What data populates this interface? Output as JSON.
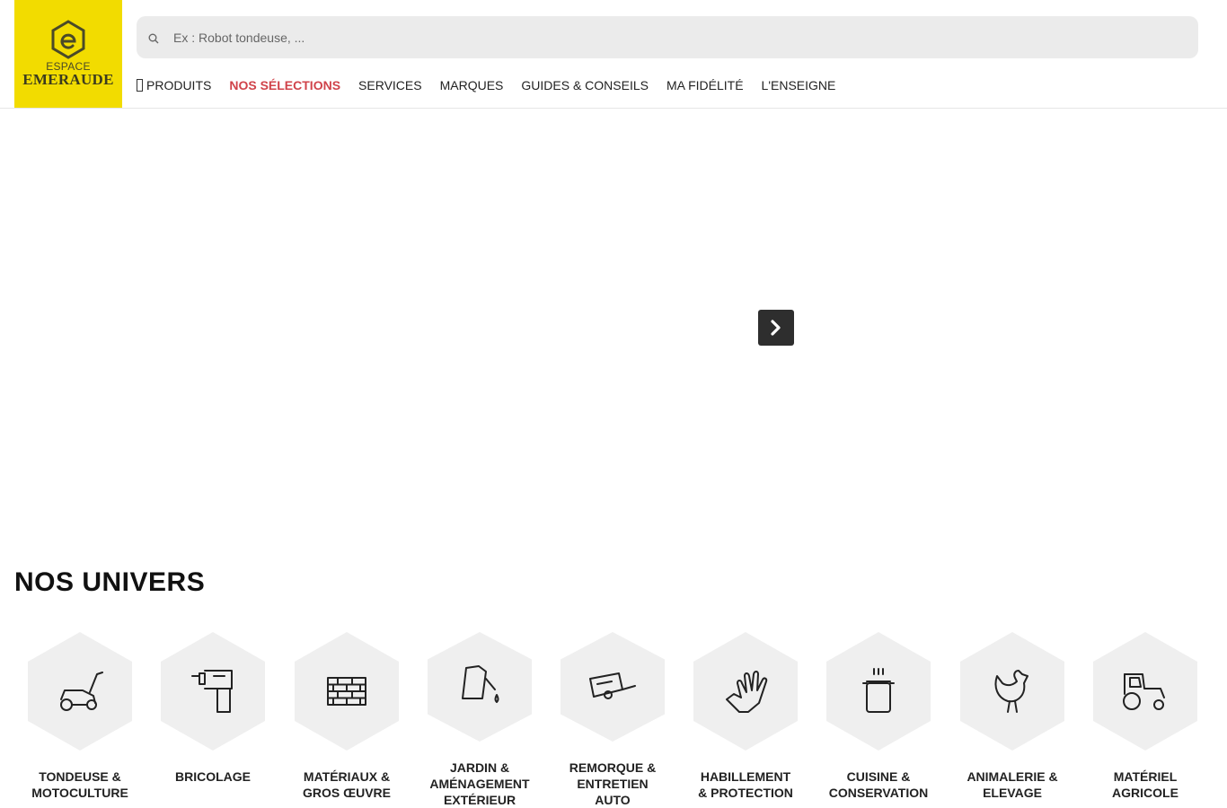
{
  "brand": {
    "logo_line1": "ESPACE",
    "logo_line2": "EMERAUDE",
    "color": "#f2dc00"
  },
  "search": {
    "placeholder": "Ex : Robot tondeuse, ...",
    "icon": "search-icon"
  },
  "nav": {
    "items": [
      {
        "label": "PRODUITS",
        "icon": "menu-icon"
      },
      {
        "label": "NOS SÉLECTIONS",
        "active": true
      },
      {
        "label": "SERVICES"
      },
      {
        "label": "MARQUES"
      },
      {
        "label": "GUIDES & CONSEILS"
      },
      {
        "label": "MA FIDÉLITÉ"
      },
      {
        "label": "L'ENSEIGNE"
      }
    ],
    "active_color": "#d0434a"
  },
  "slider": {
    "next_icon": "chevron-right-icon"
  },
  "univers": {
    "title": "NOS UNIVERS",
    "items": [
      {
        "label_l1": "TONDEUSE &",
        "label_l2": "MOTOCULTURE",
        "label_l3": "",
        "icon": "lawnmower-icon"
      },
      {
        "label_l1": "BRICOLAGE",
        "label_l2": "",
        "label_l3": "",
        "icon": "drill-icon"
      },
      {
        "label_l1": "MATÉRIAUX &",
        "label_l2": "GROS ŒUVRE",
        "label_l3": "",
        "icon": "bricks-icon"
      },
      {
        "label_l1": "JARDIN &",
        "label_l2": "AMÉNAGEMENT",
        "label_l3": "EXTÉRIEUR",
        "icon": "watering-can-icon"
      },
      {
        "label_l1": "REMORQUE &",
        "label_l2": "ENTRETIEN",
        "label_l3": "AUTO",
        "icon": "trailer-icon"
      },
      {
        "label_l1": "HABILLEMENT",
        "label_l2": "& PROTECTION",
        "label_l3": "",
        "icon": "glove-icon"
      },
      {
        "label_l1": "CUISINE &",
        "label_l2": "CONSERVATION",
        "label_l3": "",
        "icon": "cooking-pot-icon"
      },
      {
        "label_l1": "ANIMALERIE &",
        "label_l2": "ELEVAGE",
        "label_l3": "",
        "icon": "hen-icon"
      },
      {
        "label_l1": "MATÉRIEL",
        "label_l2": "AGRICOLE",
        "label_l3": "",
        "icon": "tractor-icon"
      }
    ]
  }
}
